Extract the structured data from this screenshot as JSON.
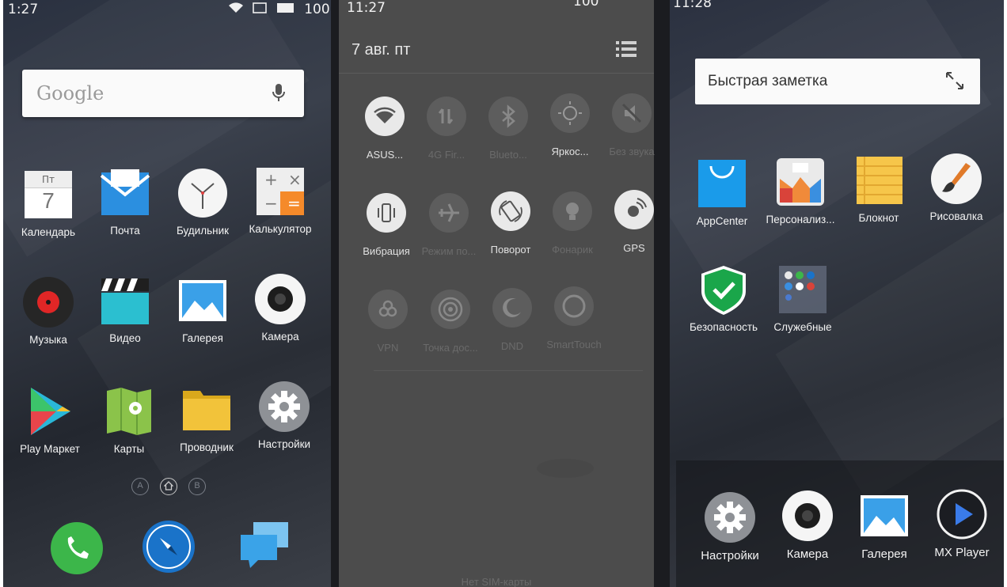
{
  "panel1": {
    "status": {
      "time": "1:27",
      "battery": "100"
    },
    "search": {
      "logo": "Google",
      "mic_icon": "mic-icon"
    },
    "apps": [
      {
        "label": "Календарь",
        "icon": "calendar-icon",
        "day": "Пт",
        "date": "7"
      },
      {
        "label": "Почта",
        "icon": "mail-icon"
      },
      {
        "label": "Будильник",
        "icon": "clock-icon"
      },
      {
        "label": "Калькулятор",
        "icon": "calculator-icon"
      },
      {
        "label": "Музыка",
        "icon": "music-icon"
      },
      {
        "label": "Видео",
        "icon": "video-icon"
      },
      {
        "label": "Галерея",
        "icon": "gallery-icon"
      },
      {
        "label": "Камера",
        "icon": "camera-icon"
      },
      {
        "label": "Play Маркет",
        "icon": "play-store-icon"
      },
      {
        "label": "Карты",
        "icon": "maps-icon"
      },
      {
        "label": "Проводник",
        "icon": "folder-icon"
      },
      {
        "label": "Настройки",
        "icon": "gear-icon"
      }
    ],
    "pager": [
      "A",
      "B"
    ],
    "dock": [
      "phone-icon",
      "browser-icon",
      "messages-icon"
    ]
  },
  "panel2": {
    "status": {
      "time": "11:27",
      "battery": "100"
    },
    "date": "7 авг. пт",
    "toggles": [
      {
        "label": "ASUS...",
        "icon": "wifi-icon",
        "on": true
      },
      {
        "label": "4G Fir...",
        "icon": "mobile-data-icon",
        "on": false
      },
      {
        "label": "Blueto...",
        "icon": "bluetooth-icon",
        "on": false
      },
      {
        "label": "Яркос...",
        "icon": "brightness-icon",
        "on": true
      },
      {
        "label": "Без звука",
        "icon": "mute-icon",
        "on": false
      },
      {
        "label": "Вибрация",
        "icon": "vibration-icon",
        "on": true
      },
      {
        "label": "Режим по...",
        "icon": "airplane-icon",
        "on": false
      },
      {
        "label": "Поворот",
        "icon": "rotate-icon",
        "on": true
      },
      {
        "label": "Фонарик",
        "icon": "flashlight-icon",
        "on": false
      },
      {
        "label": "GPS",
        "icon": "gps-icon",
        "on": true
      },
      {
        "label": "VPN",
        "icon": "vpn-icon",
        "on": false
      },
      {
        "label": "Точка дос...",
        "icon": "hotspot-icon",
        "on": false
      },
      {
        "label": "DND",
        "icon": "moon-icon",
        "on": false
      },
      {
        "label": "SmartTouch",
        "icon": "smarttouch-icon",
        "on": false
      }
    ],
    "footer": "Нет SIM-карты"
  },
  "panel3": {
    "status": {
      "time": "11:28"
    },
    "note": {
      "label": "Быстрая заметка"
    },
    "apps": [
      {
        "label": "AppCenter",
        "icon": "appcenter-icon"
      },
      {
        "label": "Персонализ...",
        "icon": "personalization-icon"
      },
      {
        "label": "Блокнот",
        "icon": "notepad-icon"
      },
      {
        "label": "Рисовалка",
        "icon": "paint-icon"
      },
      {
        "label": "Безопасность",
        "icon": "security-icon"
      },
      {
        "label": "Служебные",
        "icon": "utilities-folder-icon"
      }
    ],
    "dock": [
      {
        "label": "Настройки",
        "icon": "gear-icon"
      },
      {
        "label": "Камера",
        "icon": "camera-icon"
      },
      {
        "label": "Галерея",
        "icon": "gallery-icon"
      },
      {
        "label": "MX Player",
        "icon": "mx-player-icon"
      }
    ]
  }
}
